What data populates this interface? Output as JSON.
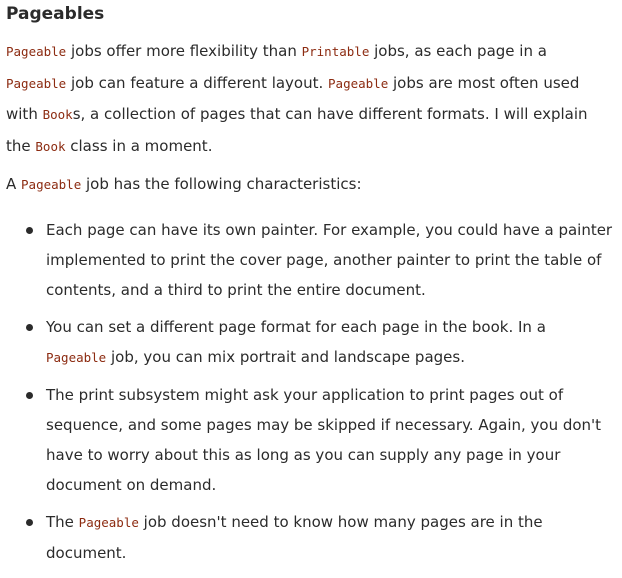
{
  "heading": "Pageables",
  "para1": {
    "l1_code1": "Pageable",
    "l1_t1": " jobs offer more flexibility than ",
    "l1_code2": "Printable",
    "l1_t2": " jobs, as each page in a",
    "l2_code1": "Pageable",
    "l2_t1": " job can feature a different layout. ",
    "l2_code2": "Pageable",
    "l2_t2": " jobs are most often used",
    "l3_t1": "with ",
    "l3_code1": "Book",
    "l3_t2": "s, a collection of pages that can have different formats. I will explain",
    "l4_t1": "the ",
    "l4_code1": "Book",
    "l4_t2": " class in a moment."
  },
  "para2": {
    "t1": "A ",
    "code1": "Pageable",
    "t2": " job has the following characteristics:"
  },
  "bullets": {
    "b1": {
      "l1": "Each page can have its own painter. For example, you could have a painter",
      "l2": "implemented to print the cover page, another painter to print the table of",
      "l3": "contents, and a third to print the entire document."
    },
    "b2": {
      "l1": "You can set a different page format for each page in the book. In a",
      "l2_code": "Pageable",
      "l2_t": " job, you can mix portrait and landscape pages."
    },
    "b3": {
      "l1": "The print subsystem might ask your application to print pages out of",
      "l2": "sequence, and some pages may be skipped if necessary. Again, you don't",
      "l3": "have to worry about this as long as you can supply any page in your",
      "l4": "document on demand."
    },
    "b4": {
      "l1_t1": "The ",
      "l1_code": "Pageable",
      "l1_t2": " job doesn't need to know how many pages are in the",
      "l2": "document."
    }
  },
  "colors": {
    "text": "#2b2b2b",
    "code": "#8c2b11",
    "background": "#ffffff"
  }
}
